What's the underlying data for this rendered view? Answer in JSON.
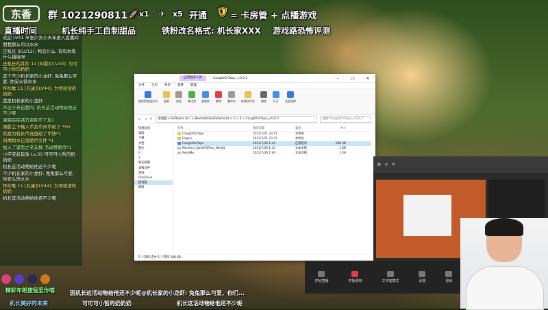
{
  "overlay": {
    "logo": "东香",
    "fan_group": "群 1021290811",
    "rocket_count": "x1",
    "plane_count": "x5",
    "kaitong": "开通",
    "kaitong_rest": "= 卡房管 + 点播游戏",
    "line2_a": "直播时间",
    "line2_b": "机长纯手工自制甜品",
    "line2_c": "铁粉改名格式: 机长家XXX",
    "line2_d": "游戏路恐怖评测"
  },
  "chat": [
    {
      "text": "欢迎 LV41 半张少女小天年进入直播间",
      "cls": ""
    },
    {
      "text": "朋我那么可以水水",
      "cls": ""
    },
    {
      "text": "庄机长 3(LV12): 鸭岛什么: 有吗你看什么描绘呀",
      "cls": ""
    },
    {
      "text": "庄机长的并抄 11 [幻影][CV30]: 可可可小哲的奶奶",
      "cls": "y"
    },
    {
      "text": "这个不少机长家的小龙虾: 兔兔那么可爱, 你安么快水水",
      "cls": ""
    },
    {
      "text": "怀抄歌 11 [孔雀][LV44]: 为啥班按的奶奶",
      "cls": "y"
    },
    {
      "text": "我是机长家的小龙虾",
      "cls": ""
    },
    {
      "text": "齐达于来自我吗, 机长这活动物给他还不少呢",
      "cls": "g"
    },
    {
      "text": "骑狼民民减方资助币了加1",
      "cls": "g"
    },
    {
      "text": "萧影之下输入币及币州币给了 *50",
      "cls": "y"
    },
    {
      "text": "有愿为机长币充值给了币快*1",
      "cls": "y"
    },
    {
      "text": "刘晴和水已资助币实件 *1",
      "cls": "y"
    },
    {
      "text": "加入了谋思之老友群 活动赞助币*1",
      "cls": "g"
    },
    {
      "text": "小学究歧皆效 Lv.30 可可可小哲的奶奶奶",
      "cls": ""
    },
    {
      "text": "机长这活动物给他还不少呢",
      "cls": ""
    },
    {
      "text": "不少机长家的小龙虾: 兔兔那么可爱, 你安么快水水",
      "cls": ""
    },
    {
      "text": "怀抄歌 11 [孔雀][LV44]: 为啥班按的奶奶",
      "cls": "y"
    },
    {
      "text": "机长这活动物给他还不少呢",
      "cls": ""
    }
  ],
  "explorer": {
    "tab_label": "应用程序工具",
    "title": "CaughtOnTape_v.0.0.2",
    "ribbon_tabs": [
      "文件",
      "主页",
      "共享",
      "查看",
      "管理"
    ],
    "ribbon_buttons": [
      "固定到快速访问",
      "复制",
      "粘贴",
      "移动到",
      "复制到",
      "删除",
      "重命名",
      "新建文件夹",
      "属性",
      "打开",
      "全部选择"
    ],
    "address": "此电脑 > Software (H:) > BaiduNetdiskDownload > 1 > 4 > CaughtOnTape_v.0.0.2",
    "search_placeholder": "搜索\"CaughtOnTape_v.0.0.2\"",
    "nav_items": [
      "快速访问",
      "桌面",
      "下载",
      "文档",
      "图片",
      "0",
      "1",
      "机长视频",
      "录像文件",
      "游戏",
      "OneDrive",
      "此电脑",
      "网络"
    ],
    "columns": [
      "名称",
      "修改日期",
      "类型",
      "大小"
    ],
    "files": [
      {
        "name": "CaughtOnTape",
        "date": "2021/7/21 23:21",
        "type": "文件夹",
        "size": ""
      },
      {
        "name": "Engine",
        "date": "2021/7/21 23:21",
        "type": "文件夹",
        "size": ""
      },
      {
        "name": "CaughtOnTape",
        "date": "2021/7/26 1:44",
        "type": "应用程序",
        "size": "188 KB"
      },
      {
        "name": "Manifest_NonUFSFiles_Win64",
        "date": "2021/7/26 1:43",
        "type": "文本文档",
        "size": "1 KB"
      },
      {
        "name": "ReadMe",
        "date": "2021/7/26 1:06",
        "type": "文本文档",
        "size": "1 KB"
      }
    ],
    "status": "5 个项目    选中 1 个项目 188 KB"
  },
  "obs_buttons": [
    "开始直播",
    "开始录制",
    "工作室模式",
    "设置",
    "退出"
  ],
  "bottom": {
    "ticker1": "精彩布朗旅程爱你喵",
    "ticker2": "因机长这活动物给他还不少呢@机长家的小龙虾: 兔兔那么可爱、你们...",
    "ticker3": "机长美好的未来",
    "ticker4": "可可可小哲的奶奶奶",
    "ticker5": "机长这活动物给他还不少呢"
  },
  "colors": {
    "gift1": "#e0407a",
    "gift2": "#5a3cc8",
    "gift3": "#2a2a5a",
    "gift4": "#c87a20"
  }
}
